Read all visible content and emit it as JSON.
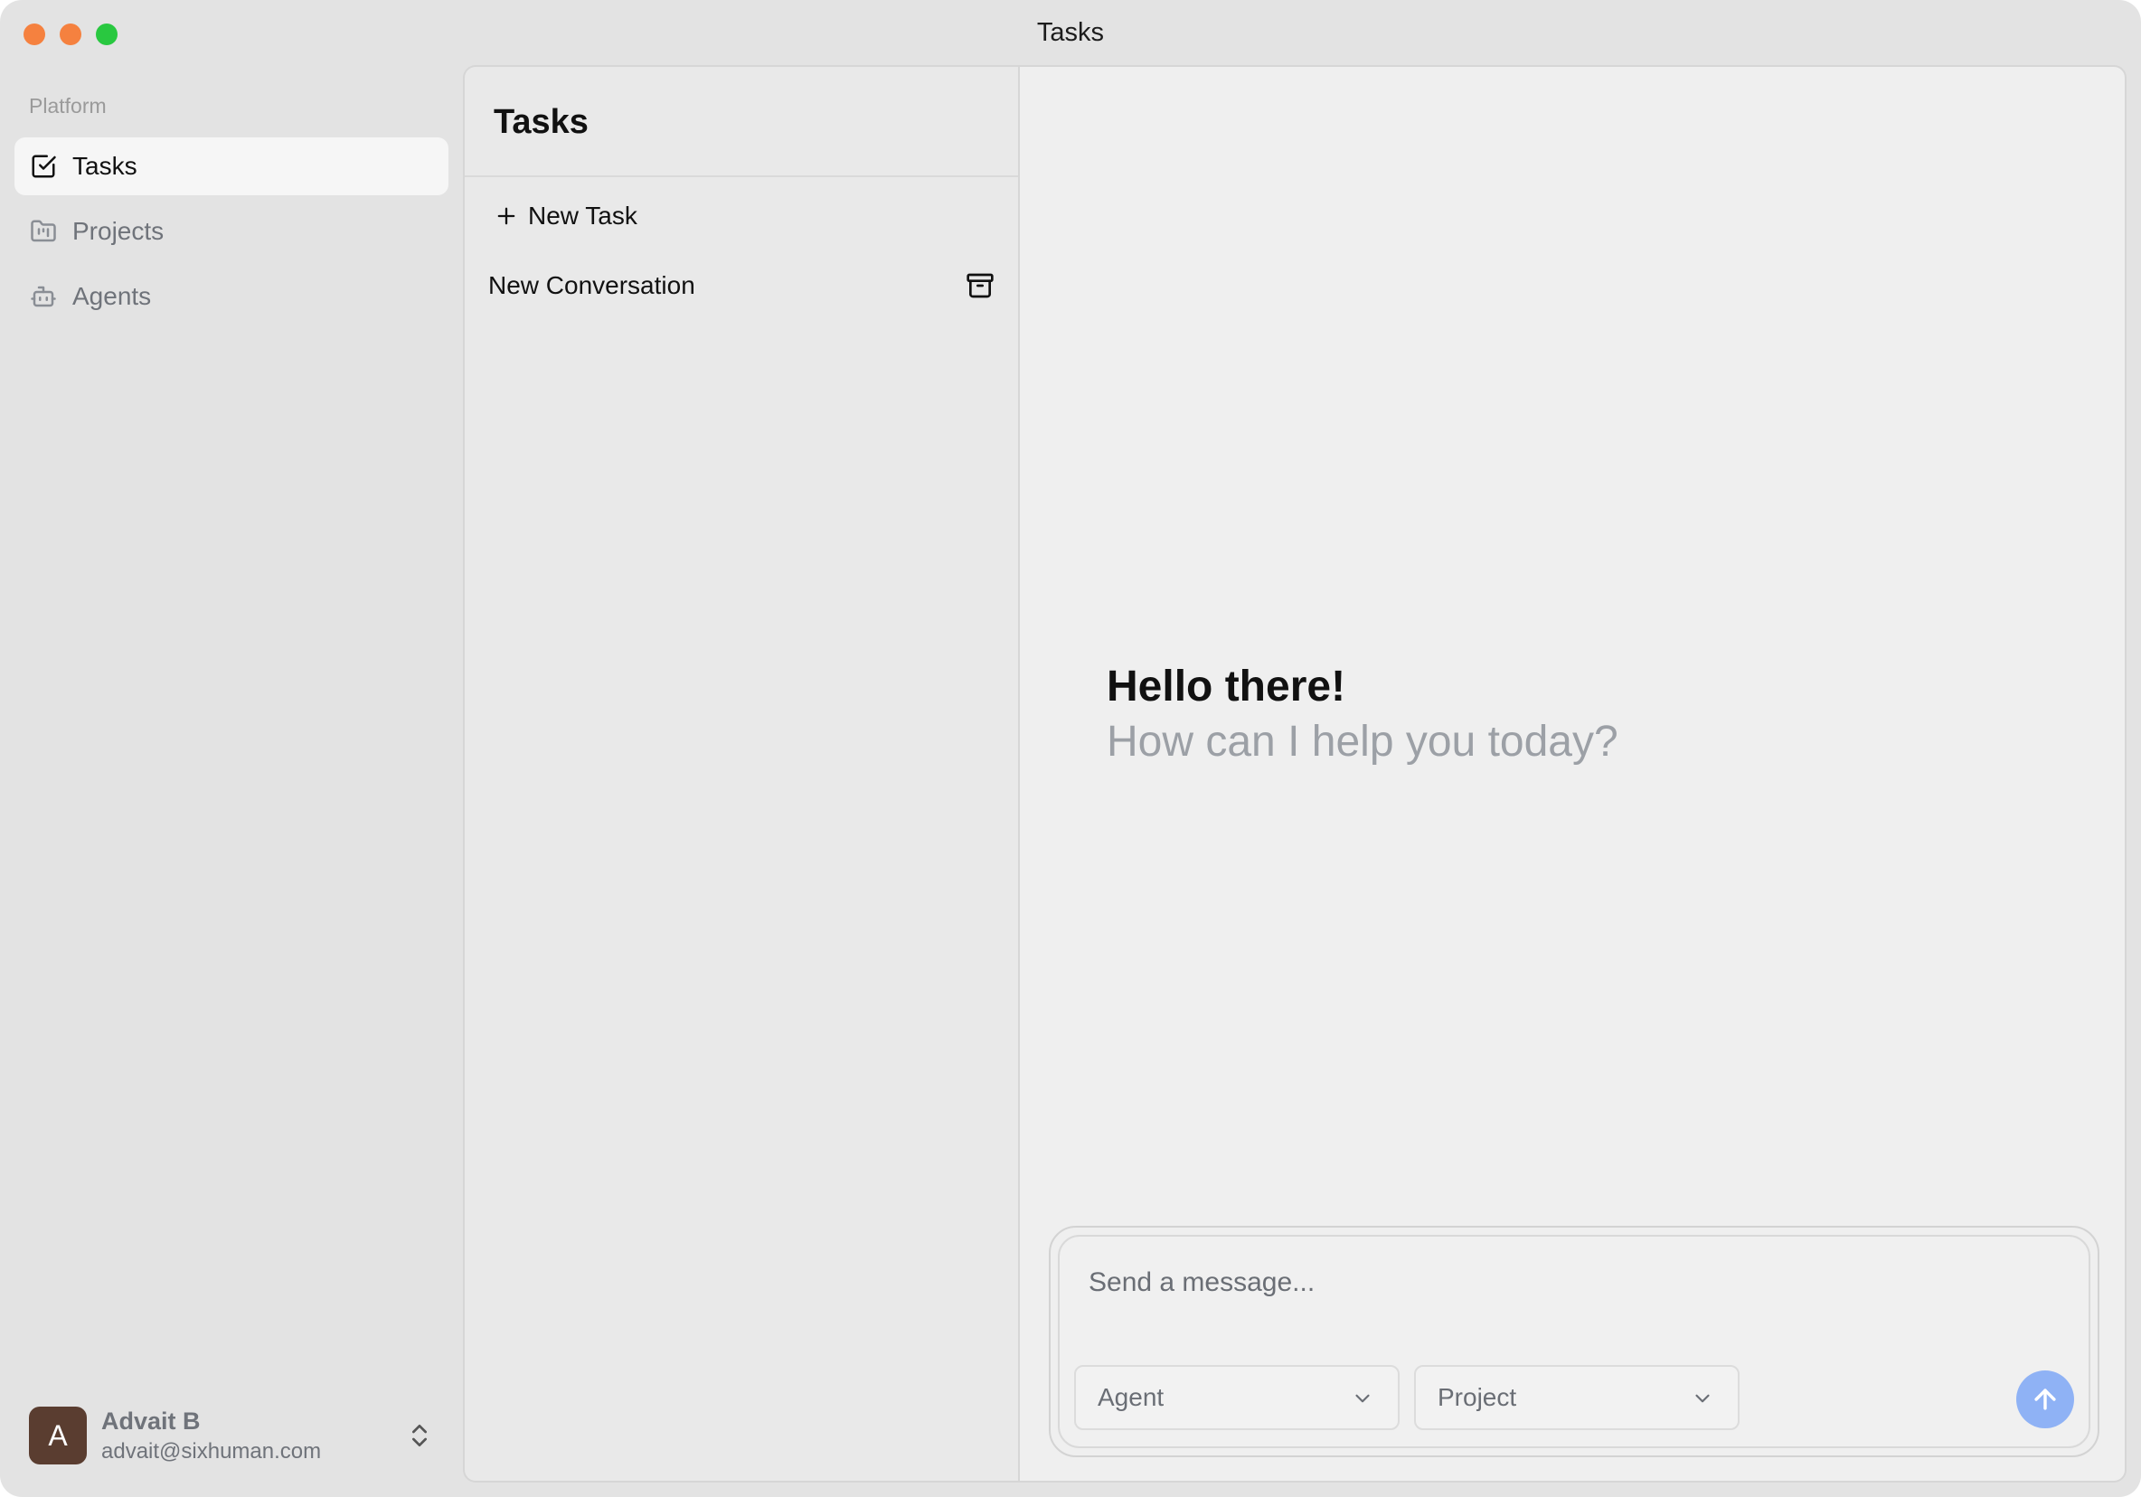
{
  "window": {
    "title": "Tasks"
  },
  "sidebar": {
    "section_label": "Platform",
    "items": [
      {
        "label": "Tasks",
        "icon": "square-check-icon",
        "active": true
      },
      {
        "label": "Projects",
        "icon": "folder-kanban-icon",
        "active": false
      },
      {
        "label": "Agents",
        "icon": "bot-icon",
        "active": false
      }
    ],
    "user": {
      "initial": "A",
      "name": "Advait B",
      "email": "advait@sixhuman.com"
    }
  },
  "tasks_panel": {
    "title": "Tasks",
    "new_task_label": "New Task",
    "conversations": [
      {
        "title": "New Conversation"
      }
    ]
  },
  "main": {
    "greeting_title": "Hello there!",
    "greeting_subtitle": "How can I help you today?",
    "composer": {
      "placeholder": "Send a message...",
      "agent_select": "Agent",
      "project_select": "Project"
    }
  },
  "colors": {
    "accent_send": "#8fb2f5",
    "avatar_bg": "#5a3d30",
    "traffic_close": "#f5813f",
    "traffic_minimize": "#f5813f",
    "traffic_maximize": "#29c840"
  }
}
